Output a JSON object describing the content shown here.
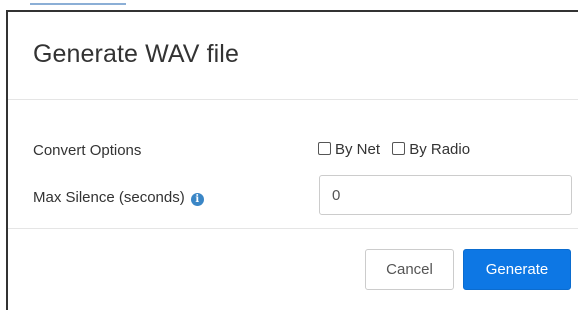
{
  "modal": {
    "title": "Generate WAV file"
  },
  "form": {
    "convert_options": {
      "label": "Convert Options",
      "options": [
        {
          "label": "By Net",
          "checked": false
        },
        {
          "label": "By Radio",
          "checked": false
        }
      ]
    },
    "max_silence": {
      "label": "Max Silence (seconds)",
      "info_icon": "info-icon",
      "value": "0"
    }
  },
  "footer": {
    "cancel_label": "Cancel",
    "generate_label": "Generate"
  },
  "colors": {
    "primary": "#0d77e4",
    "info": "#3a86c6"
  }
}
